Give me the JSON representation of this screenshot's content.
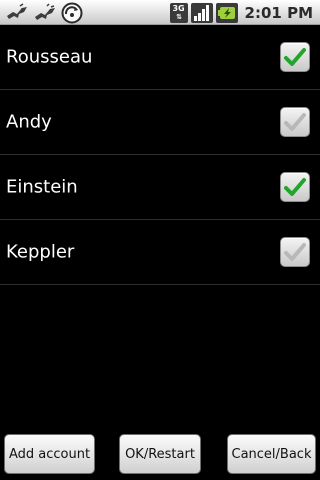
{
  "status_bar": {
    "left_icons": [
      "usb-debug-icon",
      "usb-icon",
      "sync-icon"
    ],
    "right_icons": [
      "network-3g-icon",
      "signal-icon",
      "battery-icon"
    ],
    "network_label": "3G",
    "time": "2:01 PM"
  },
  "accounts": [
    {
      "label": "Rousseau",
      "checked": true,
      "enabled": true
    },
    {
      "label": "Andy",
      "checked": true,
      "enabled": false
    },
    {
      "label": "Einstein",
      "checked": true,
      "enabled": true
    },
    {
      "label": "Keppler",
      "checked": true,
      "enabled": false
    }
  ],
  "buttons": {
    "add_account": "Add account",
    "ok_restart": "OK/Restart",
    "cancel_back": "Cancel/Back"
  },
  "colors": {
    "check_enabled": "#22a52c",
    "check_disabled": "#b8b8b8",
    "list_background": "#000000",
    "divider": "#2e2e2e"
  }
}
